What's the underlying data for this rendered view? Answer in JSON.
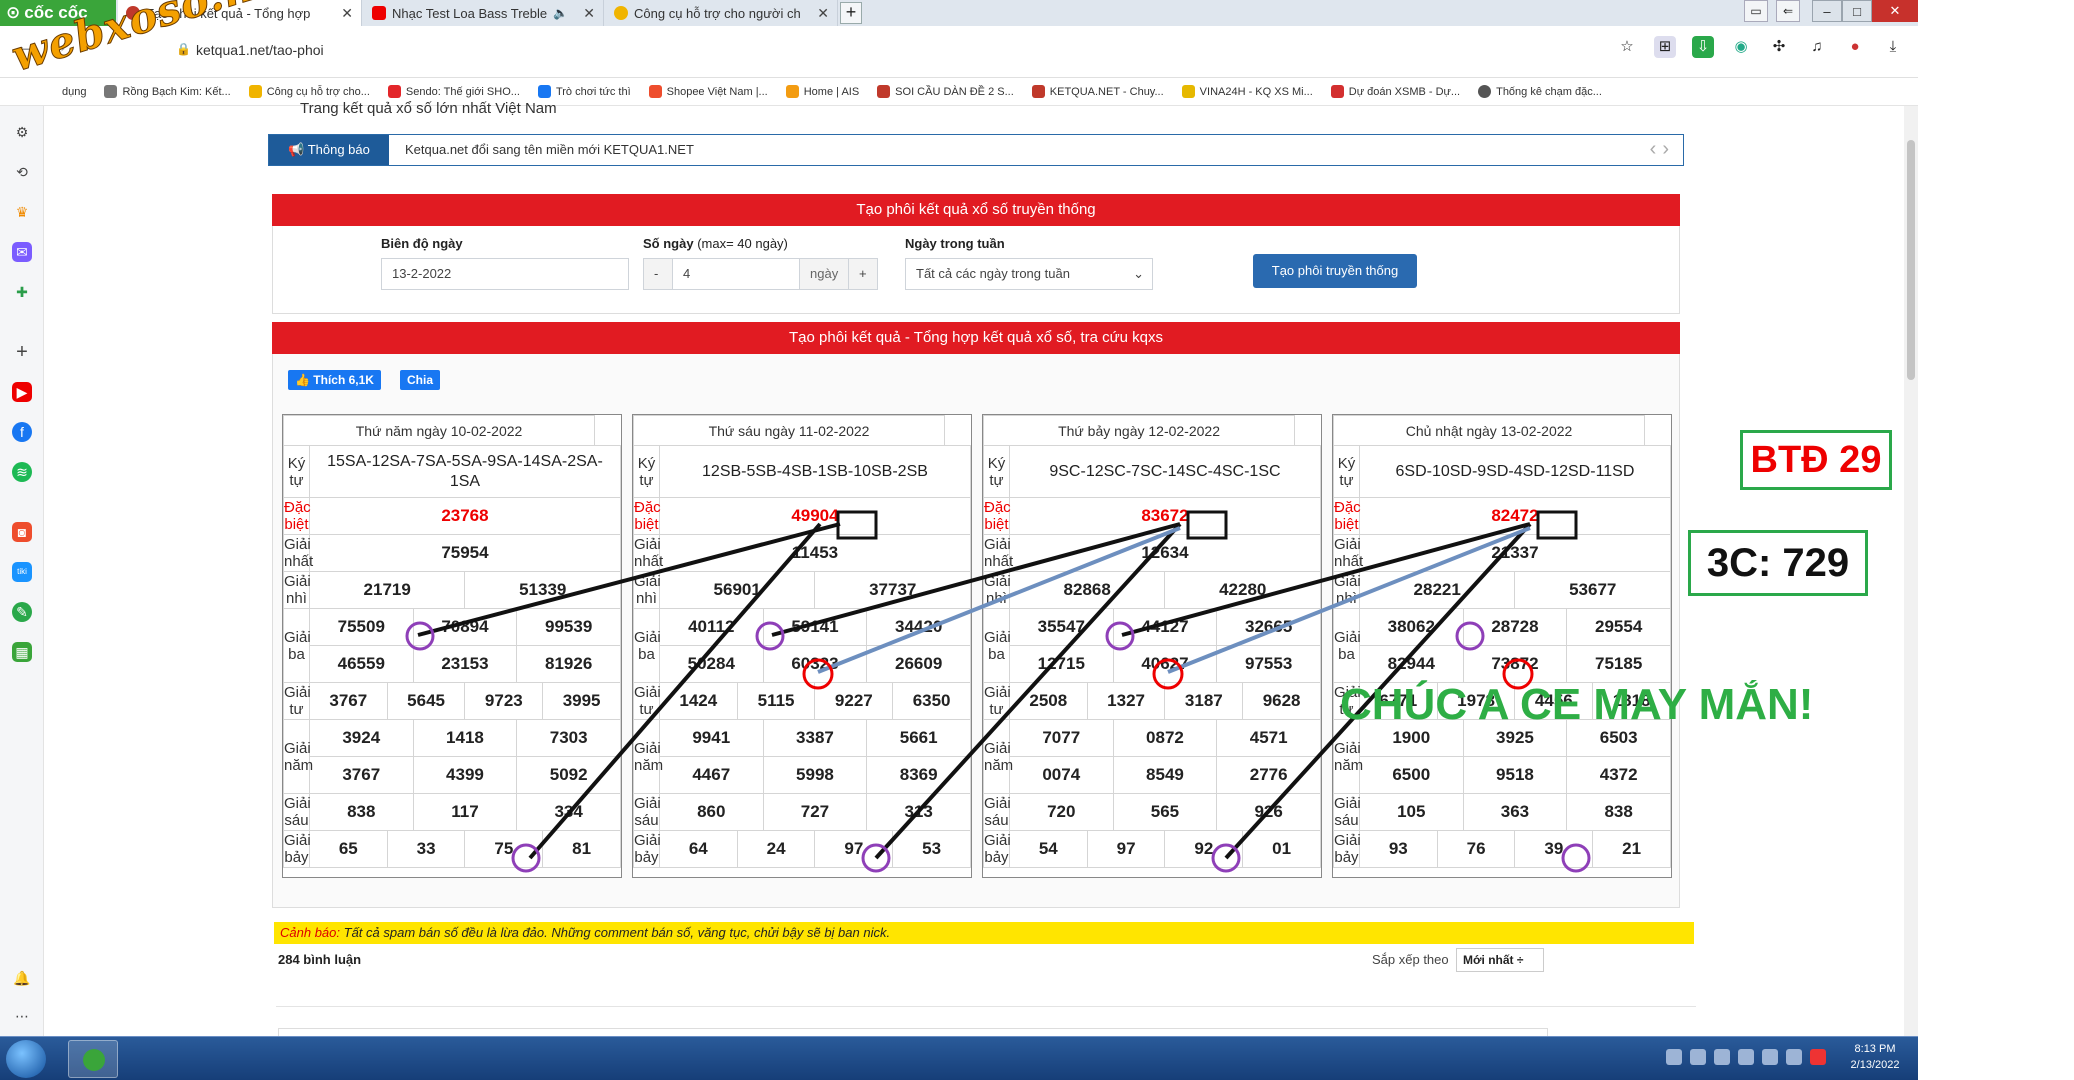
{
  "browser": {
    "brand": "cốc cốc",
    "tabs": [
      {
        "title": "Tạo phôi kết quả - Tổng hợp",
        "active": true
      },
      {
        "title": "Nhạc Test Loa Bass Treble",
        "active": false
      },
      {
        "title": "Công cụ hỗ trợ cho người ch",
        "active": false
      }
    ],
    "url": "ketqua1.net/tao-phoi",
    "bookmarks": [
      "dụng",
      "Rồng Bạch Kim: Kết...",
      "Công cụ hỗ trợ cho...",
      "Sendo: Thế giới SHO...",
      "Trò chơi tức thì",
      "Shopee Việt Nam |...",
      "Home | AIS",
      "SOI CẦU DÀN ĐỀ 2 S...",
      "KETQUA.NET - Chuy...",
      "VINA24H - KQ XS Mi...",
      "Dự đoán XSMB - Dự...",
      "Thống kê chạm đặc..."
    ],
    "watermark": "webxoso.net"
  },
  "page": {
    "subtitle": "Trang kết quả xổ số lớn nhất Việt Nam",
    "notice_label": "Thông báo",
    "notice_text": "Ketqua.net đổi sang tên miền mới KETQUA1.NET",
    "form_title": "Tạo phôi kết quả xổ số truyền thống",
    "form": {
      "bien_do_label": "Biên độ ngày",
      "bien_do_value": "13-2-2022",
      "so_ngay_label": "Số ngày",
      "so_ngay_hint": "(max= 40 ngày)",
      "so_ngay_value": "4",
      "minus": "-",
      "plus": "+",
      "unit": "ngày",
      "ngay_trong_tuan_label": "Ngày trong tuần",
      "ngay_trong_tuan_value": "Tất cả các ngày trong tuần",
      "button": "Tạo phôi truyền thống"
    },
    "result_title": "Tạo phôi kết quả - Tổng hợp kết quả xổ số, tra cứu kqxs",
    "fb_like": "Thích 6,1K",
    "fb_share": "Chia"
  },
  "days": [
    {
      "header": "Thứ năm ngày 10-02-2022",
      "labels": {
        "kytu": "Ký tự",
        "db": "Đặc biệt",
        "g1": "Giải nhất",
        "g2": "Giải nhì",
        "g3": "Giải ba",
        "g4": "Giải tư",
        "g5": "Giải năm",
        "g6": "Giải sáu",
        "g7": "Giải bảy"
      },
      "kytu": "15SA-12SA-7SA-5SA-9SA-14SA-2SA-1SA",
      "db": "23768",
      "g1": "75954",
      "g2": [
        "21719",
        "51339"
      ],
      "g3": [
        "75509",
        "70894",
        "99539",
        "46559",
        "23153",
        "81926"
      ],
      "g4": [
        "3767",
        "5645",
        "9723",
        "3995"
      ],
      "g5": [
        "3924",
        "1418",
        "7303",
        "3767",
        "4399",
        "5092"
      ],
      "g6": [
        "838",
        "117",
        "334"
      ],
      "g7": [
        "65",
        "33",
        "75",
        "81"
      ]
    },
    {
      "header": "Thứ sáu ngày 11-02-2022",
      "labels": {
        "kytu": "Ký tự",
        "db": "Đặc biệt",
        "g1": "Giải nhất",
        "g2": "Giải nhì",
        "g3": "Giải ba",
        "g4": "Giải tư",
        "g5": "Giải năm",
        "g6": "Giải sáu",
        "g7": "Giải bảy"
      },
      "kytu": "12SB-5SB-4SB-1SB-10SB-2SB",
      "db": "49904",
      "g1": "11453",
      "g2": [
        "56901",
        "37737"
      ],
      "g3": [
        "40112",
        "59141",
        "34420",
        "50284",
        "60323",
        "26609"
      ],
      "g4": [
        "1424",
        "5115",
        "9227",
        "6350"
      ],
      "g5": [
        "9941",
        "3387",
        "5661",
        "4467",
        "5998",
        "8369"
      ],
      "g6": [
        "860",
        "727",
        "313"
      ],
      "g7": [
        "64",
        "24",
        "97",
        "53"
      ]
    },
    {
      "header": "Thứ bảy ngày 12-02-2022",
      "labels": {
        "kytu": "Ký tự",
        "db": "Đặc biệt",
        "g1": "Giải nhất",
        "g2": "Giải nhì",
        "g3": "Giải ba",
        "g4": "Giải tư",
        "g5": "Giải năm",
        "g6": "Giải sáu",
        "g7": "Giải bảy"
      },
      "kytu": "9SC-12SC-7SC-14SC-4SC-1SC",
      "db": "83672",
      "g1": "12634",
      "g2": [
        "82868",
        "42280"
      ],
      "g3": [
        "35547",
        "44127",
        "32665",
        "12715",
        "40627",
        "97553"
      ],
      "g4": [
        "2508",
        "1327",
        "3187",
        "9628"
      ],
      "g5": [
        "7077",
        "0872",
        "4571",
        "0074",
        "8549",
        "2776"
      ],
      "g6": [
        "720",
        "565",
        "926"
      ],
      "g7": [
        "54",
        "97",
        "92",
        "01"
      ]
    },
    {
      "header": "Chủ nhật ngày 13-02-2022",
      "labels": {
        "kytu": "Ký tự",
        "db": "Đặc biệt",
        "g1": "Giải nhất",
        "g2": "Giải nhì",
        "g3": "Giải ba",
        "g4": "Giải tư",
        "g5": "Giải năm",
        "g6": "Giải sáu",
        "g7": "Giải bảy"
      },
      "kytu": "6SD-10SD-9SD-4SD-12SD-11SD",
      "db": "82472",
      "g1": "21337",
      "g2": [
        "28221",
        "53677"
      ],
      "g3": [
        "38062",
        "28728",
        "29554",
        "82944",
        "73872",
        "75185"
      ],
      "g4": [
        "6771",
        "1978",
        "4456",
        "1818"
      ],
      "g5": [
        "1900",
        "3925",
        "6503",
        "6500",
        "9518",
        "4372"
      ],
      "g6": [
        "105",
        "363",
        "838"
      ],
      "g7": [
        "93",
        "76",
        "39",
        "21"
      ]
    }
  ],
  "annotations": {
    "btd": "BTĐ 29",
    "bac": "3C: 729",
    "luck": "CHÚC A CE MAY MẮN!"
  },
  "footer": {
    "warn_label": "Cảnh báo:",
    "warn_text": "Tất cả spam bán số đều là lừa đảo. Những comment bán số, văng tục, chửi bậy sẽ bị ban nick.",
    "comments": "284 bình luận",
    "sort_label": "Sắp xếp theo",
    "sort_value": "Mới nhất ÷"
  },
  "taskbar": {
    "time": "8:13 PM",
    "date": "2/13/2022"
  },
  "colors": {
    "accent_red": "#e11b22",
    "primary_blue": "#2a6ab0",
    "annot_green": "#2eae45"
  }
}
